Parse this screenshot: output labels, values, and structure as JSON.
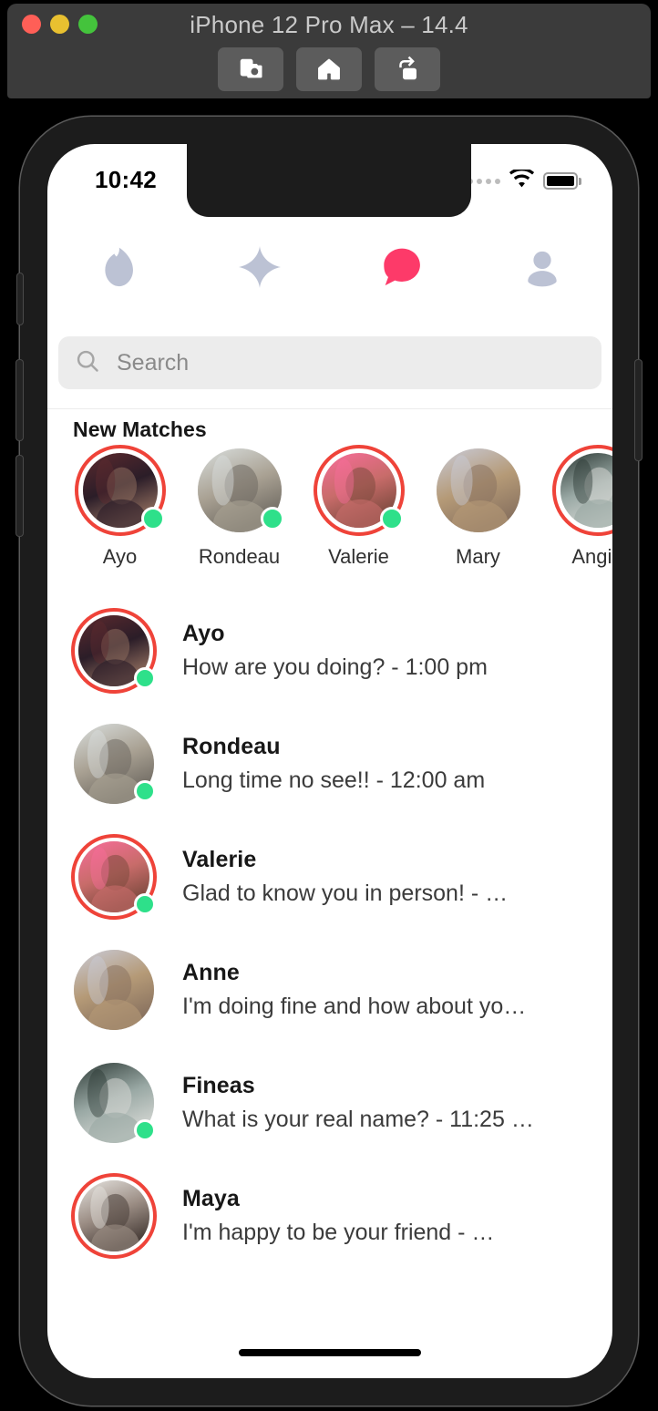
{
  "simulator": {
    "title": "iPhone 12 Pro Max – 14.4",
    "traffic_lights": [
      "close",
      "minimize",
      "zoom"
    ],
    "toolbar_buttons": [
      {
        "name": "screenshot-button",
        "icon": "camera-icon"
      },
      {
        "name": "home-button",
        "icon": "home-icon"
      },
      {
        "name": "rotate-button",
        "icon": "rotate-right-icon"
      }
    ]
  },
  "status_bar": {
    "time": "10:42",
    "cellular_icon": "cellular-dots-icon",
    "wifi_icon": "wifi-icon",
    "battery_icon": "battery-full-icon"
  },
  "tab_bar": {
    "active_index": 2,
    "active_color": "#fd3a69",
    "inactive_color": "#bcc2d4",
    "tabs": [
      {
        "name": "tab-discover",
        "icon": "flame-icon",
        "active": false
      },
      {
        "name": "tab-top-picks",
        "icon": "sparkle-icon",
        "active": false
      },
      {
        "name": "tab-messages",
        "icon": "chat-bubble-icon",
        "active": true
      },
      {
        "name": "tab-profile",
        "icon": "person-icon",
        "active": false
      }
    ]
  },
  "search": {
    "icon": "search-icon",
    "placeholder": "Search",
    "value": ""
  },
  "new_matches": {
    "title": "New Matches",
    "items": [
      {
        "name": "Ayo",
        "ring": true,
        "online": true,
        "c1": "#5d2a2e",
        "c2": "#2b1d28",
        "c3": "#8d6b5c"
      },
      {
        "name": "Rondeau",
        "ring": false,
        "online": true,
        "c1": "#d9dedd",
        "c2": "#a9a193",
        "c3": "#6f6a62"
      },
      {
        "name": "Valerie",
        "ring": true,
        "online": true,
        "c1": "#f96d9b",
        "c2": "#c86c6a",
        "c3": "#7d4a3e"
      },
      {
        "name": "Mary",
        "ring": false,
        "online": false,
        "c1": "#c9cbd8",
        "c2": "#b59a77",
        "c3": "#8a7360"
      },
      {
        "name": "Angie",
        "ring": true,
        "online": false,
        "c1": "#2d3a36",
        "c2": "#99a8a4",
        "c3": "#d3d6d2"
      }
    ]
  },
  "chats": [
    {
      "name": "Ayo",
      "message": "How are you doing? - 1:00 pm",
      "ring": true,
      "online": true,
      "c1": "#5d2a2e",
      "c2": "#2b1d28",
      "c3": "#8d6b5c"
    },
    {
      "name": "Rondeau",
      "message": "Long time no see!! - 12:00 am",
      "ring": false,
      "online": true,
      "c1": "#d9dedd",
      "c2": "#a9a193",
      "c3": "#6f6a62"
    },
    {
      "name": "Valerie",
      "message": "Glad to know you in person! - …",
      "ring": true,
      "online": true,
      "c1": "#f96d9b",
      "c2": "#c86c6a",
      "c3": "#7d4a3e"
    },
    {
      "name": "Anne",
      "message": "I'm doing fine and how about yo…",
      "ring": false,
      "online": false,
      "c1": "#c9cbd8",
      "c2": "#b59a77",
      "c3": "#8a7360"
    },
    {
      "name": "Fineas",
      "message": "What is your real name? - 11:25 …",
      "ring": false,
      "online": true,
      "c1": "#2d3a36",
      "c2": "#99a8a4",
      "c3": "#d3d6d2"
    },
    {
      "name": "Maya",
      "message": "I'm happy to be your friend - …",
      "ring": true,
      "online": false,
      "c1": "#e6e4e0",
      "c2": "#9b8d84",
      "c3": "#4a3f3a"
    }
  ],
  "colors": {
    "accent_ring": "#ef4339",
    "online_dot": "#2ee08a",
    "search_bg": "#ececec",
    "frame": "#1c1c1c"
  },
  "home_indicator": "home-indicator"
}
